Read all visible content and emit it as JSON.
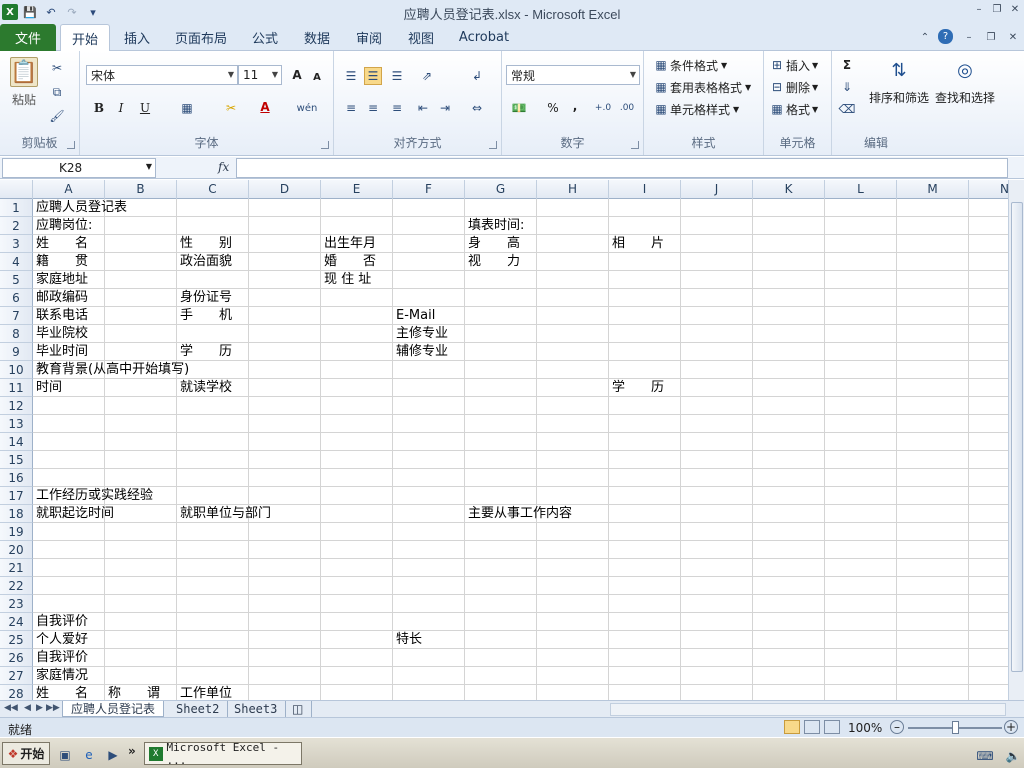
{
  "window": {
    "title": "应聘人员登记表.xlsx  -  Microsoft Excel",
    "minimize": "–",
    "restore": "❐",
    "close": "✕"
  },
  "tabs": [
    "文件",
    "开始",
    "插入",
    "页面布局",
    "公式",
    "数据",
    "审阅",
    "视图",
    "Acrobat"
  ],
  "ribbon": {
    "clipboard": {
      "paste": "粘贴",
      "label": "剪贴板"
    },
    "font": {
      "name": "宋体",
      "size": "11",
      "bold": "B",
      "italic": "I",
      "underline": "U",
      "grow": "A",
      "shrink": "A",
      "label": "字体"
    },
    "alignment": {
      "label": "对齐方式"
    },
    "number": {
      "format": "常规",
      "percent": "%",
      "comma": ",",
      "label": "数字"
    },
    "styles": {
      "conditional": "条件格式",
      "table": "套用表格格式",
      "cell": "单元格样式",
      "label": "样式"
    },
    "cells": {
      "insert": "插入",
      "delete": "删除",
      "format": "格式",
      "label": "单元格"
    },
    "editing": {
      "sigma": "Σ",
      "sort": "排序和筛选",
      "find": "查找和选择",
      "label": "编辑"
    }
  },
  "formula_bar": {
    "name_box": "K28",
    "fx": "fx",
    "formula": ""
  },
  "columns": [
    "A",
    "B",
    "C",
    "D",
    "E",
    "F",
    "G",
    "H",
    "I",
    "J",
    "K",
    "L",
    "M",
    "N"
  ],
  "rows": [
    "1",
    "2",
    "3",
    "4",
    "5",
    "6",
    "7",
    "8",
    "9",
    "10",
    "11",
    "12",
    "13",
    "14",
    "15",
    "16",
    "17",
    "18",
    "19",
    "20",
    "21",
    "22",
    "23",
    "24",
    "25",
    "26",
    "27",
    "28"
  ],
  "cells": [
    {
      "row": 1,
      "col": 0,
      "text": "应聘人员登记表"
    },
    {
      "row": 2,
      "col": 0,
      "text": "应聘岗位:"
    },
    {
      "row": 2,
      "col": 6,
      "text": "填表时间:"
    },
    {
      "row": 3,
      "col": 0,
      "text": "姓　　名"
    },
    {
      "row": 3,
      "col": 2,
      "text": "性　　别"
    },
    {
      "row": 3,
      "col": 4,
      "text": "出生年月"
    },
    {
      "row": 3,
      "col": 6,
      "text": "身　　高"
    },
    {
      "row": 3,
      "col": 8,
      "text": "相　　片"
    },
    {
      "row": 4,
      "col": 0,
      "text": "籍　　贯"
    },
    {
      "row": 4,
      "col": 2,
      "text": "政治面貌"
    },
    {
      "row": 4,
      "col": 4,
      "text": "婚　　否"
    },
    {
      "row": 4,
      "col": 6,
      "text": "视　　力"
    },
    {
      "row": 5,
      "col": 0,
      "text": "家庭地址"
    },
    {
      "row": 5,
      "col": 4,
      "text": "现 住 址"
    },
    {
      "row": 6,
      "col": 0,
      "text": "邮政编码"
    },
    {
      "row": 6,
      "col": 2,
      "text": "身份证号"
    },
    {
      "row": 7,
      "col": 0,
      "text": "联系电话"
    },
    {
      "row": 7,
      "col": 2,
      "text": "手　　机"
    },
    {
      "row": 7,
      "col": 5,
      "text": "E-Mail"
    },
    {
      "row": 8,
      "col": 0,
      "text": "毕业院校"
    },
    {
      "row": 8,
      "col": 5,
      "text": "主修专业"
    },
    {
      "row": 9,
      "col": 0,
      "text": "毕业时间"
    },
    {
      "row": 9,
      "col": 2,
      "text": "学　　历"
    },
    {
      "row": 9,
      "col": 5,
      "text": "辅修专业"
    },
    {
      "row": 10,
      "col": 0,
      "text": "教育背景(从高中开始填写)"
    },
    {
      "row": 11,
      "col": 0,
      "text": "时间"
    },
    {
      "row": 11,
      "col": 2,
      "text": "就读学校"
    },
    {
      "row": 11,
      "col": 8,
      "text": "学　　历"
    },
    {
      "row": 17,
      "col": 0,
      "text": "工作经历或实践经验"
    },
    {
      "row": 18,
      "col": 0,
      "text": "就职起讫时间"
    },
    {
      "row": 18,
      "col": 2,
      "text": "就职单位与部门"
    },
    {
      "row": 18,
      "col": 6,
      "text": "主要从事工作内容"
    },
    {
      "row": 24,
      "col": 0,
      "text": "自我评价"
    },
    {
      "row": 25,
      "col": 0,
      "text": "个人爱好"
    },
    {
      "row": 25,
      "col": 5,
      "text": "特长"
    },
    {
      "row": 26,
      "col": 0,
      "text": "自我评价"
    },
    {
      "row": 27,
      "col": 0,
      "text": "家庭情况"
    },
    {
      "row": 28,
      "col": 0,
      "text": "姓　　名"
    },
    {
      "row": 28,
      "col": 1,
      "text": "称　　谓"
    },
    {
      "row": 28,
      "col": 2,
      "text": "工作单位"
    }
  ],
  "sheets": [
    "应聘人员登记表",
    "Sheet2",
    "Sheet3"
  ],
  "status": {
    "ready": "就绪",
    "zoom": "100%"
  },
  "taskbar": {
    "start": "开始",
    "excel": "Microsoft Excel - ..."
  }
}
